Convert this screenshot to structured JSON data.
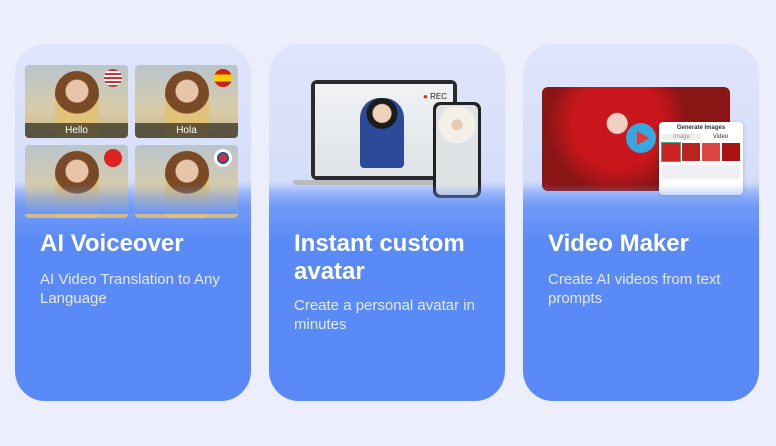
{
  "cards": [
    {
      "title": "AI Voiceover",
      "subtitle": "AI Video Translation to Any Language",
      "tiles": [
        {
          "caption": "Hello",
          "flag": "us-flag-icon"
        },
        {
          "caption": "Hola",
          "flag": "spain-flag-icon"
        },
        {
          "caption": "",
          "flag": "china-flag-icon"
        },
        {
          "caption": "",
          "flag": "korea-flag-icon"
        }
      ]
    },
    {
      "title": "Instant custom avatar",
      "subtitle": "Create a personal avatar in minutes",
      "rec": "REC"
    },
    {
      "title": "Video Maker",
      "subtitle": "Create AI videos from text prompts",
      "panel": {
        "title": "Generate Images",
        "tabs": [
          "Image",
          "Video"
        ]
      }
    }
  ],
  "colors": {
    "card_blue": "#5a8af7",
    "background": "#eceffb"
  }
}
